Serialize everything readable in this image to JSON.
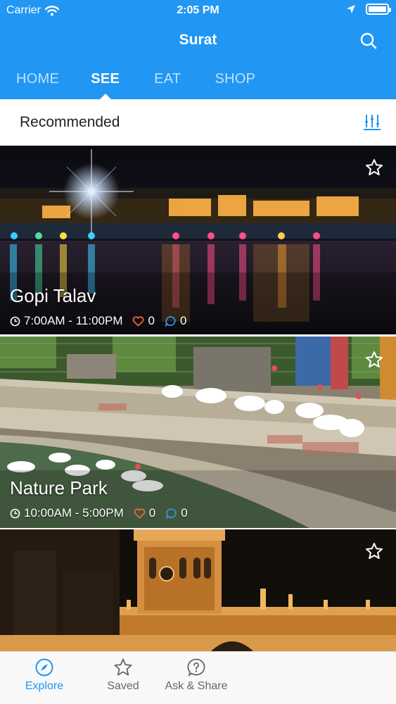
{
  "status_bar": {
    "carrier": "Carrier",
    "time": "2:05 PM"
  },
  "header": {
    "title": "Surat",
    "search_icon": "search-icon"
  },
  "tabs": [
    {
      "label": "HOME",
      "active": false
    },
    {
      "label": "SEE",
      "active": true
    },
    {
      "label": "EAT",
      "active": false
    },
    {
      "label": "SHOP",
      "active": false
    }
  ],
  "section": {
    "title": "Recommended",
    "filter_icon": "filter-icon"
  },
  "places": [
    {
      "name": "Gopi Talav",
      "hours": "7:00AM - 11:00PM",
      "likes": "0",
      "comments": "0"
    },
    {
      "name": "Nature Park",
      "hours": "10:00AM - 5:00PM",
      "likes": "0",
      "comments": "0"
    },
    {
      "name": "",
      "hours": "",
      "likes": "",
      "comments": ""
    }
  ],
  "bottom_tabs": [
    {
      "label": "Explore",
      "icon": "compass-icon",
      "active": true
    },
    {
      "label": "Saved",
      "icon": "star-icon",
      "active": false
    },
    {
      "label": "Ask & Share",
      "icon": "question-bubble-icon",
      "active": false
    }
  ],
  "colors": {
    "primary": "#2196f3",
    "like": "#f0663a",
    "comment": "#3a8fe0"
  }
}
